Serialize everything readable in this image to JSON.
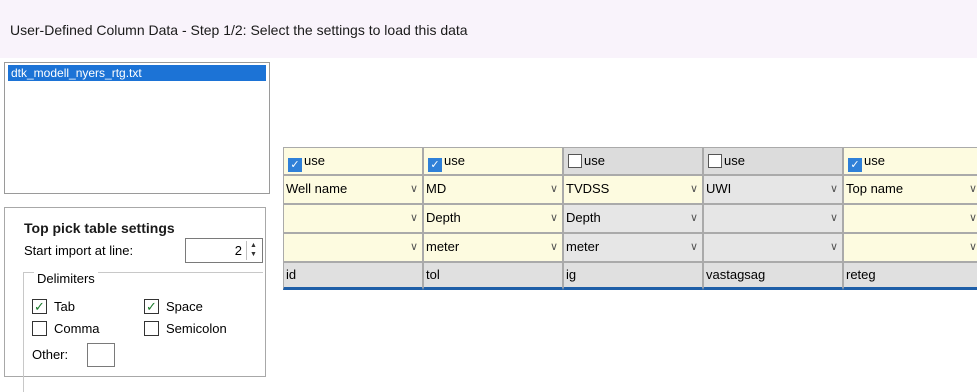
{
  "window": {
    "title": "User-Defined Column Data - Step 1/2: Select the settings to load this data"
  },
  "file_list": {
    "items": [
      "dtk_modell_nyers_rtg.txt"
    ],
    "selected": 0
  },
  "settings": {
    "heading": "Top pick table settings",
    "start_label": "Start import at line:",
    "start_value": "2",
    "delimiters": {
      "legend": "Delimiters",
      "tab": {
        "label": "Tab",
        "checked": true
      },
      "space": {
        "label": "Space",
        "checked": true
      },
      "comma": {
        "label": "Comma",
        "checked": false
      },
      "semicolon": {
        "label": "Semicolon",
        "checked": false
      },
      "other": {
        "label": "Other:",
        "value": ""
      }
    }
  },
  "columns": [
    {
      "use_label": "use",
      "use": true,
      "kind": "Well name",
      "unit_type": "",
      "unit": "",
      "source": "id"
    },
    {
      "use_label": "use",
      "use": true,
      "kind": "MD",
      "unit_type": "Depth",
      "unit": "meter",
      "source": "tol"
    },
    {
      "use_label": "use",
      "use": false,
      "kind": "TVDSS",
      "unit_type": "Depth",
      "unit": "meter",
      "source": "ig"
    },
    {
      "use_label": "use",
      "use": false,
      "kind": "UWI",
      "unit_type": "",
      "unit": "",
      "source": "vastagsag"
    },
    {
      "use_label": "use",
      "use": true,
      "kind": "Top name",
      "unit_type": "",
      "unit": "",
      "source": "reteg"
    }
  ]
}
